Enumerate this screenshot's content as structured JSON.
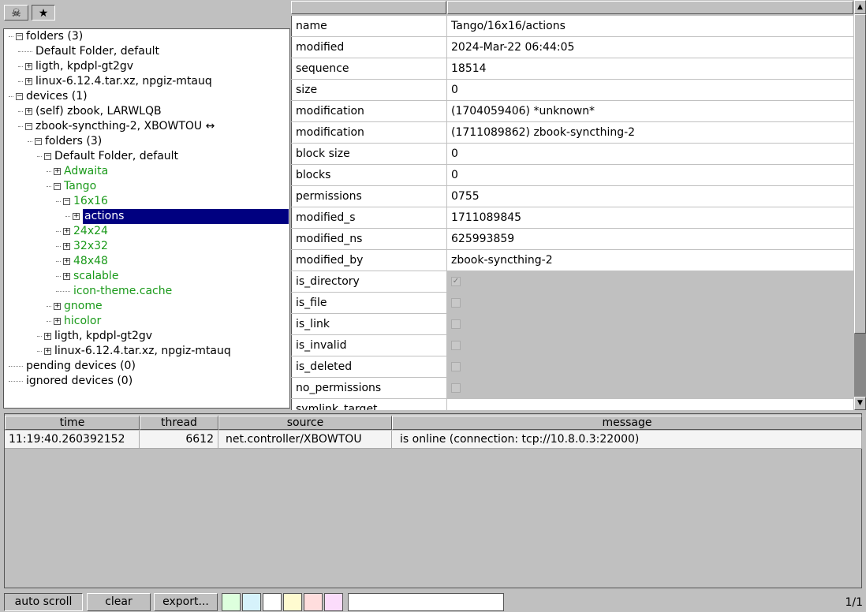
{
  "toolbar": {
    "skull_icon": "☠",
    "star_icon": "★"
  },
  "tree": [
    {
      "label": "folders (3)",
      "level": 0,
      "box": "−",
      "color": "black"
    },
    {
      "label": "Default Folder, default",
      "level": 1,
      "box": "",
      "color": "black"
    },
    {
      "label": "ligth, kpdpl-gt2gv",
      "level": 1,
      "box": "+",
      "color": "black"
    },
    {
      "label": "linux-6.12.4.tar.xz, npgiz-mtauq",
      "level": 1,
      "box": "+",
      "color": "black"
    },
    {
      "label": "devices (1)",
      "level": 0,
      "box": "−",
      "color": "black"
    },
    {
      "label": "(self) zbook, LARWLQB",
      "level": 1,
      "box": "+",
      "color": "black"
    },
    {
      "label": "zbook-syncthing-2, XBOWTOU ↔",
      "level": 1,
      "box": "−",
      "color": "black"
    },
    {
      "label": "folders (3)",
      "level": 2,
      "box": "−",
      "color": "black"
    },
    {
      "label": "Default Folder, default",
      "level": 3,
      "box": "−",
      "color": "black"
    },
    {
      "label": "Adwaita",
      "level": 4,
      "box": "+",
      "color": "green"
    },
    {
      "label": "Tango",
      "level": 4,
      "box": "−",
      "color": "green"
    },
    {
      "label": "16x16",
      "level": 5,
      "box": "−",
      "color": "green"
    },
    {
      "label": "actions",
      "level": 6,
      "box": "+",
      "color": "selected"
    },
    {
      "label": "24x24",
      "level": 5,
      "box": "+",
      "color": "green"
    },
    {
      "label": "32x32",
      "level": 5,
      "box": "+",
      "color": "green"
    },
    {
      "label": "48x48",
      "level": 5,
      "box": "+",
      "color": "green"
    },
    {
      "label": "scalable",
      "level": 5,
      "box": "+",
      "color": "green"
    },
    {
      "label": "icon-theme.cache",
      "level": 5,
      "box": "",
      "color": "green"
    },
    {
      "label": "gnome",
      "level": 4,
      "box": "+",
      "color": "green"
    },
    {
      "label": "hicolor",
      "level": 4,
      "box": "+",
      "color": "green"
    },
    {
      "label": "ligth, kpdpl-gt2gv",
      "level": 3,
      "box": "+",
      "color": "black"
    },
    {
      "label": "linux-6.12.4.tar.xz, npgiz-mtauq",
      "level": 3,
      "box": "+",
      "color": "black"
    },
    {
      "label": "pending devices (0)",
      "level": 0,
      "box": "",
      "color": "black"
    },
    {
      "label": "ignored devices (0)",
      "level": 0,
      "box": "",
      "color": "black"
    }
  ],
  "properties": [
    {
      "key": "name",
      "value": "Tango/16x16/actions"
    },
    {
      "key": "modified",
      "value": "2024-Mar-22 06:44:05"
    },
    {
      "key": "sequence",
      "value": "18514"
    },
    {
      "key": "size",
      "value": "0"
    },
    {
      "key": "modification",
      "value": "(1704059406) *unknown*"
    },
    {
      "key": "modification",
      "value": "(1711089862) zbook-syncthing-2"
    },
    {
      "key": "block size",
      "value": "0"
    },
    {
      "key": "blocks",
      "value": "0"
    },
    {
      "key": "permissions",
      "value": "0755"
    },
    {
      "key": "modified_s",
      "value": "1711089845"
    },
    {
      "key": "modified_ns",
      "value": "625993859"
    },
    {
      "key": "modified_by",
      "value": "zbook-syncthing-2"
    },
    {
      "key": "is_directory",
      "checked": true
    },
    {
      "key": "is_file",
      "checked": false
    },
    {
      "key": "is_link",
      "checked": false
    },
    {
      "key": "is_invalid",
      "checked": false
    },
    {
      "key": "is_deleted",
      "checked": false
    },
    {
      "key": "no_permissions",
      "checked": false
    },
    {
      "key": "symlink_target",
      "value": ""
    }
  ],
  "log": {
    "headers": [
      "time",
      "thread",
      "source",
      "message"
    ],
    "rows": [
      [
        "11:19:40.260392152",
        "6612",
        "net.controller/XBOWTOU",
        "is online (connection: tcp://10.8.0.3:22000)"
      ]
    ]
  },
  "bottom": {
    "auto_scroll": "auto scroll",
    "clear": "clear",
    "export": "export...",
    "filter_value": "",
    "page": "1/1",
    "swatches": [
      "#ddffdd",
      "#d6f2fb",
      "#ffffff",
      "#fffbd0",
      "#ffdddd",
      "#fbdcfb"
    ]
  }
}
